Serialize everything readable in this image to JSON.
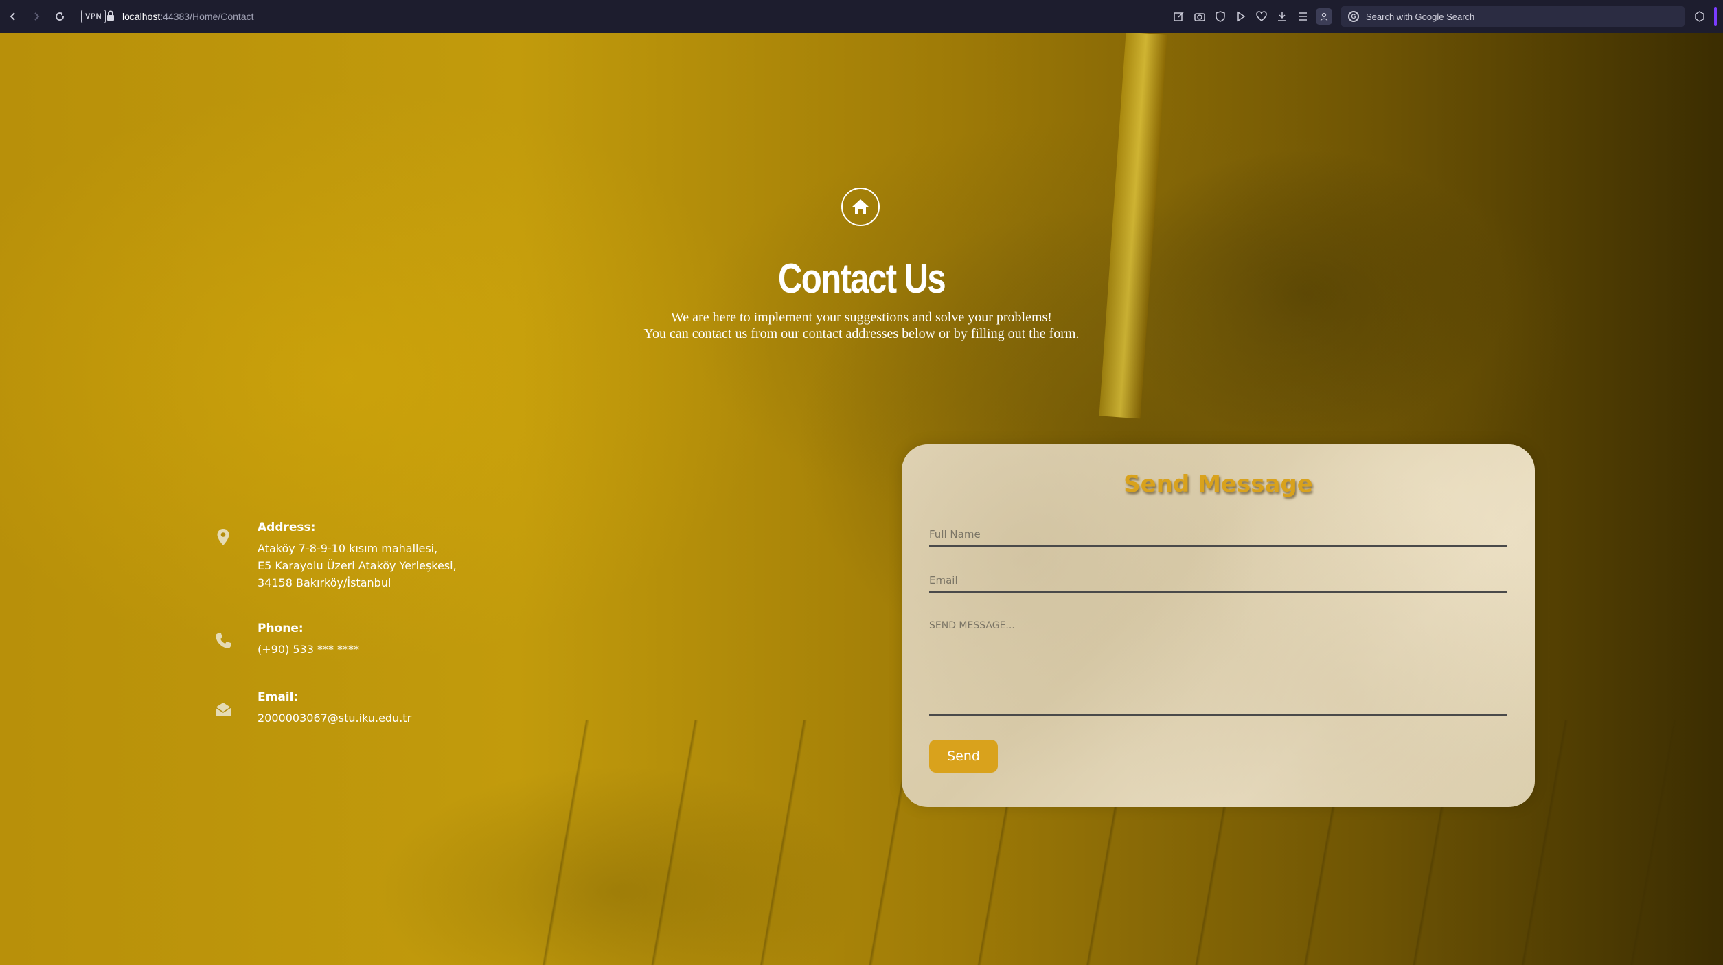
{
  "browser": {
    "vpn_label": "VPN",
    "url_host": "localhost",
    "url_rest": ":44383/Home/Contact",
    "search_placeholder": "Search with Google Search",
    "search_engine_glyph": "G",
    "accent_color": "#7a3cff"
  },
  "hero": {
    "icon": "home-icon",
    "title": "Contact Us",
    "subtitle_line1": "We are here to implement your suggestions and solve your problems!",
    "subtitle_line2": "You can contact us from our contact addresses below or by filling out the form."
  },
  "contact": {
    "address": {
      "icon": "location-pin-icon",
      "label": "Address:",
      "line1": "Ataköy 7-8-9-10 kısım mahallesi,",
      "line2": "E5 Karayolu Üzeri Ataköy Yerleşkesi,",
      "line3": "34158 Bakırköy/İstanbul"
    },
    "phone": {
      "icon": "phone-icon",
      "label": "Phone:",
      "value": "(+90) 533 *** ****"
    },
    "email": {
      "icon": "envelope-open-icon",
      "label": "Email:",
      "value": "2000003067@stu.iku.edu.tr"
    }
  },
  "form": {
    "title": "Send Message",
    "full_name_placeholder": "Full Name",
    "email_placeholder": "Email",
    "message_placeholder": "SEND MESSAGE...",
    "send_label": "Send",
    "accent_color": "#d9a21c"
  }
}
